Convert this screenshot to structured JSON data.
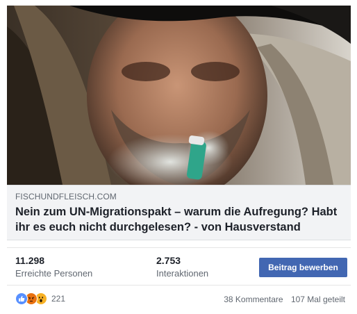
{
  "post": {
    "domain": "FISCHUNDFLEISCH.COM",
    "title": "Nein zum UN-Migrationspakt – warum die Aufregung? Habt ihr es euch nicht durchgelesen? - von Hausverstand"
  },
  "stats": {
    "reach_value": "11.298",
    "reach_label": "Erreichte Personen",
    "interactions_value": "2.753",
    "interactions_label": "Interaktionen",
    "boost_label": "Beitrag bewerben"
  },
  "footer": {
    "reactions": [
      "like-icon",
      "angry-icon",
      "wow-icon"
    ],
    "reaction_count": "221",
    "comments": "38 Kommentare",
    "shares": "107 Mal geteilt"
  },
  "colors": {
    "brand_blue": "#4267b2",
    "like_blue": "#5890ff",
    "angry_red": "#e9710f",
    "wow_yellow": "#f7b125"
  }
}
